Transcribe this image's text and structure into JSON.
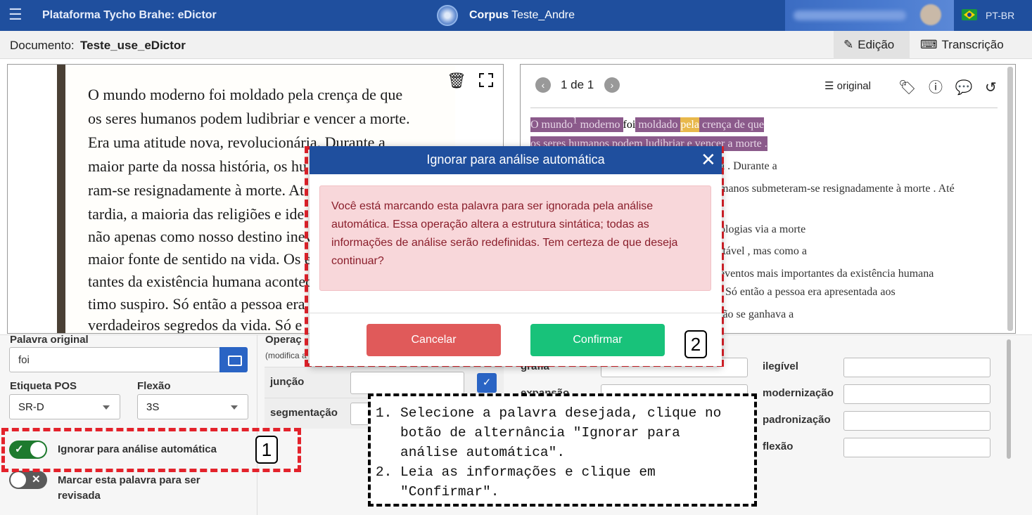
{
  "header": {
    "app_title": "Plataforma Tycho Brahe: eDictor",
    "corpus_label": "Corpus",
    "corpus_name": "Teste_Andre",
    "language": "PT-BR"
  },
  "docbar": {
    "document_label": "Documento:",
    "document_name": "Teste_use_eDictor",
    "tab_edit": "Edição",
    "tab_transcription": "Transcrição"
  },
  "image_panel": {
    "lines": [
      "O mundo moderno foi moldado pela crença de que",
      "os seres humanos podem ludibriar e vencer a morte.",
      "Era uma atitude nova, revolucionária. Durante a",
      "maior parte da nossa história, os hu",
      "ram-se resignadamente à morte. At",
      "tardia, a maioria das religiões e ide",
      "não apenas como nosso destino inev",
      "maior fonte de sentido na vida. Os ev",
      "tantes da existência humana acontec",
      "timo suspiro. Só então a pessoa era",
      "verdadeiros segredos da vida. Só e"
    ]
  },
  "text_panel": {
    "page_info": "1 de 1",
    "layer": "original",
    "line1": {
      "w1": "O mundo",
      "sup": "1",
      "w2": "moderno",
      "foi": "foi",
      "w3": "moldado",
      "pela": "pela",
      "w4": "crença de que"
    },
    "line2": "os seres humanos podem ludibriar e vencer a morte .",
    "lines": [
      "a . Durante a",
      "manos submeteram-se resignadamente à morte . Até",
      "ologias via a morte",
      "itável , mas como a",
      "eventos mais importantes da existência humana",
      ". Só então a pessoa era apresentada aos",
      "tão se ganhava a"
    ]
  },
  "form": {
    "original_word_label": "Palavra original",
    "original_word_value": "foi",
    "pos_label": "Etiqueta POS",
    "pos_value": "SR-D",
    "flexion_label": "Flexão",
    "flexion_value": "3S",
    "operations_label": "Operaç",
    "operations_sub": "(modifica a",
    "op_join": "junção",
    "op_segment": "segmentação",
    "ignore_toggle_label": "Ignorar para análise automática",
    "review_toggle_label": "Marcar esta palavra para ser revisada",
    "right_labels": [
      "grafia",
      "expansão",
      "ilegível",
      "modernização",
      "padronização",
      "flexão"
    ]
  },
  "modal": {
    "title": "Ignorar para análise automática",
    "message": "Você está marcando esta palavra para ser ignorada pela análise automática. Essa operação altera a estrutura sintática; todas as informações de análise serão redefinidas. Tem certeza de que deseja continuar?",
    "cancel": "Cancelar",
    "confirm": "Confirmar"
  },
  "callouts": {
    "one": "1",
    "two": "2"
  },
  "instructions": [
    "Selecione a palavra desejada, clique no botão de alternância \"Ignorar para análise automática\".",
    "Leia as informações e clique em \"Confirmar\"."
  ],
  "colors": {
    "header_blue": "#1f4f9e",
    "highlight_purple": "#8b5a8b",
    "highlight_yellow": "#e8b84b",
    "confirm_green": "#18c27a",
    "cancel_red": "#e05a5a",
    "callout_red": "#e3222b"
  }
}
